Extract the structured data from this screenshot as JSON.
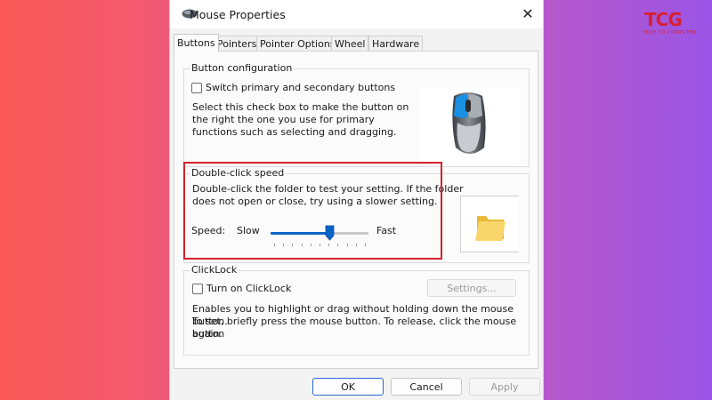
{
  "brand": {
    "mark": "TCG",
    "tagline": "TECH CO COMPUTER"
  },
  "window": {
    "title": "Mouse Properties",
    "close_glyph": "✕"
  },
  "tabs": [
    {
      "label": "Buttons",
      "active": true
    },
    {
      "label": "Pointers"
    },
    {
      "label": "Pointer Options"
    },
    {
      "label": "Wheel"
    },
    {
      "label": "Hardware"
    }
  ],
  "button_configuration": {
    "legend": "Button configuration",
    "checkbox_label": "Switch primary and secondary buttons",
    "checked": false,
    "description": "Select this check box to make the button on the right the one you use for primary functions such as selecting and dragging."
  },
  "double_click": {
    "legend": "Double-click speed",
    "description_line1": "Double-click the folder to test your setting. If the folder",
    "description_line2": "does not open or close, try using a slower setting.",
    "speed_label": "Speed:",
    "slow_label": "Slow",
    "fast_label": "Fast",
    "speed_value_fraction": 0.6,
    "highlight_color": "#d3232a"
  },
  "clicklock": {
    "legend": "ClickLock",
    "checkbox_label": "Turn on ClickLock",
    "checked": false,
    "settings_button": "Settings...",
    "description_line1": "Enables you to highlight or drag without holding down the mouse button.",
    "description_line2": "To set, briefly press the mouse button. To release, click the mouse button",
    "description_line3": "again."
  },
  "footer": {
    "ok": "OK",
    "cancel": "Cancel",
    "apply": "Apply"
  },
  "colors": {
    "accent": "#0a64c8",
    "mouse_highlight": "#1a8fe3"
  }
}
